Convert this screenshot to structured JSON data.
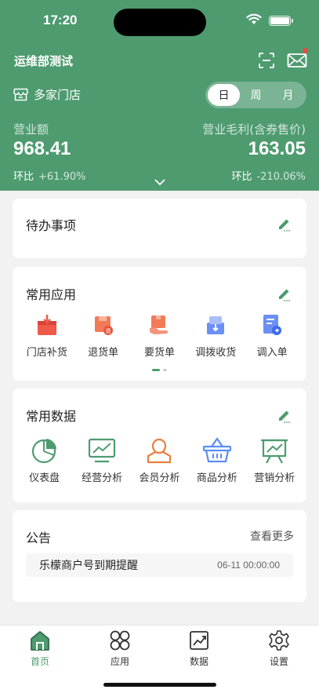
{
  "status_bar": {
    "time": "17:20"
  },
  "header": {
    "title": "运维部测试",
    "store_label": "多家门店",
    "period_tabs": [
      {
        "label": "日",
        "active": true
      },
      {
        "label": "周",
        "active": false
      },
      {
        "label": "月",
        "active": false
      }
    ],
    "revenue": {
      "label": "营业额",
      "value": "968.41",
      "cmp_label": "环比",
      "cmp_value": "+61.90%"
    },
    "gross_profit": {
      "label": "营业毛利(含券售价)",
      "value": "163.05",
      "cmp_label": "环比",
      "cmp_value": "-210.06%"
    }
  },
  "todo": {
    "title": "待办事项"
  },
  "common_apps": {
    "title": "常用应用",
    "items": [
      {
        "label": "门店补货",
        "icon": "store-replenish-icon"
      },
      {
        "label": "退货单",
        "icon": "return-order-icon"
      },
      {
        "label": "要货单",
        "icon": "request-order-icon"
      },
      {
        "label": "调拨收货",
        "icon": "transfer-receive-icon"
      },
      {
        "label": "调入单",
        "icon": "transfer-in-icon"
      }
    ]
  },
  "common_data": {
    "title": "常用数据",
    "items": [
      {
        "label": "仪表盘",
        "icon": "pie-chart-icon"
      },
      {
        "label": "经营分析",
        "icon": "monitor-chart-icon"
      },
      {
        "label": "会员分析",
        "icon": "member-icon"
      },
      {
        "label": "商品分析",
        "icon": "basket-icon"
      },
      {
        "label": "营销分析",
        "icon": "presentation-icon"
      }
    ]
  },
  "notice": {
    "title": "公告",
    "more_label": "查看更多",
    "items": [
      {
        "title": "乐檬商户号到期提醒",
        "date": "06-11 00:00:00"
      }
    ]
  },
  "tabbar": {
    "items": [
      {
        "label": "首页",
        "icon": "home-icon",
        "active": true
      },
      {
        "label": "应用",
        "icon": "apps-icon",
        "active": false
      },
      {
        "label": "数据",
        "icon": "data-icon",
        "active": false
      },
      {
        "label": "设置",
        "icon": "settings-icon",
        "active": false
      }
    ]
  },
  "colors": {
    "brand": "#4e9b70",
    "background": "#f2f2f2",
    "badge": "#e54d42"
  }
}
